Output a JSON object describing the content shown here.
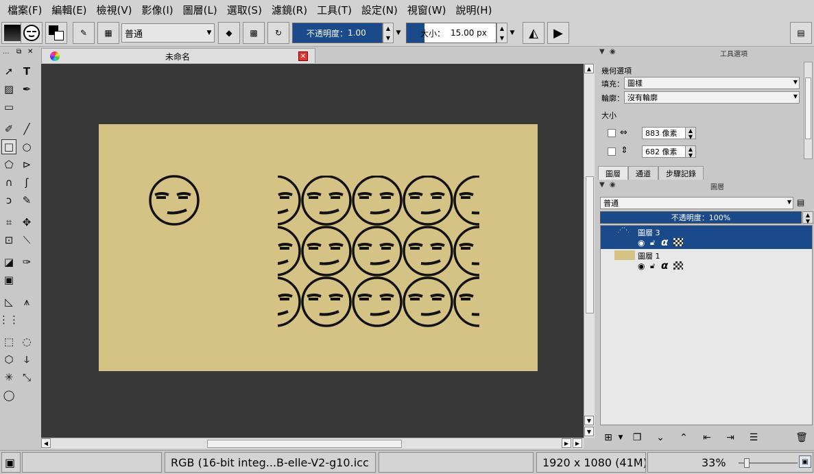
{
  "menu": [
    "檔案(F)",
    "編輯(E)",
    "檢視(V)",
    "影像(I)",
    "圖層(L)",
    "選取(S)",
    "濾鏡(R)",
    "工具(T)",
    "設定(N)",
    "視窗(W)",
    "說明(H)"
  ],
  "toolbar": {
    "blend_mode": "普通",
    "opacity_label": "不透明度：",
    "opacity_value": "1.00",
    "opacity_fraction": 1.0,
    "size_label": "大小：",
    "size_value": "15.00 px",
    "size_fraction": 0.2
  },
  "toolbox": {
    "header": "...",
    "tools": [
      "select-icon",
      "text-icon",
      "pattern-icon",
      "calligraphy-icon",
      "brush-icon",
      "line-icon",
      "rectangle-icon",
      "ellipse-icon",
      "polygon-icon",
      "polyline-icon",
      "bezier-icon",
      "freehand-path-icon",
      "dynamic-brush-icon",
      "multibrush-icon",
      "crop-icon",
      "move-icon",
      "transform-icon",
      "measure-icon",
      "fill-icon",
      "color-picker-icon",
      "gradient-icon",
      "assistant-icon",
      "perspective-icon",
      "grid-icon",
      "rect-select-icon",
      "ellipse-select-icon",
      "poly-select-icon",
      "freehand-select-icon",
      "magic-wand-icon",
      "similar-select-icon",
      "bezier-select-icon"
    ]
  },
  "document": {
    "tab_title": "未命名",
    "canvas_bg": "#383838",
    "image_color": "#d5c285"
  },
  "tool_options": {
    "header": "工具選項",
    "section": "幾何選項",
    "fill_label": "填充：",
    "fill_value": "圖樣",
    "outline_label": "輪廓：",
    "outline_value": "沒有輪廓",
    "size_label": "大小",
    "width_value": "883 像素",
    "height_value": "682 像素"
  },
  "tabs": [
    "圖層",
    "通道",
    "步驟記錄"
  ],
  "layers_panel": {
    "header": "圖層",
    "blend_mode": "普通",
    "opacity_text": "不透明度：100%",
    "layers": [
      {
        "name": "圖層 3",
        "selected": true
      },
      {
        "name": "圖層 1",
        "selected": false
      }
    ],
    "alpha_glyph": "α"
  },
  "status": {
    "color_profile": "RGB (16-bit integ...B-elle-V2-g10.icc",
    "image_size": "1920 x 1080 (41M)",
    "zoom": "33%",
    "zoom_fraction": 0.1
  }
}
